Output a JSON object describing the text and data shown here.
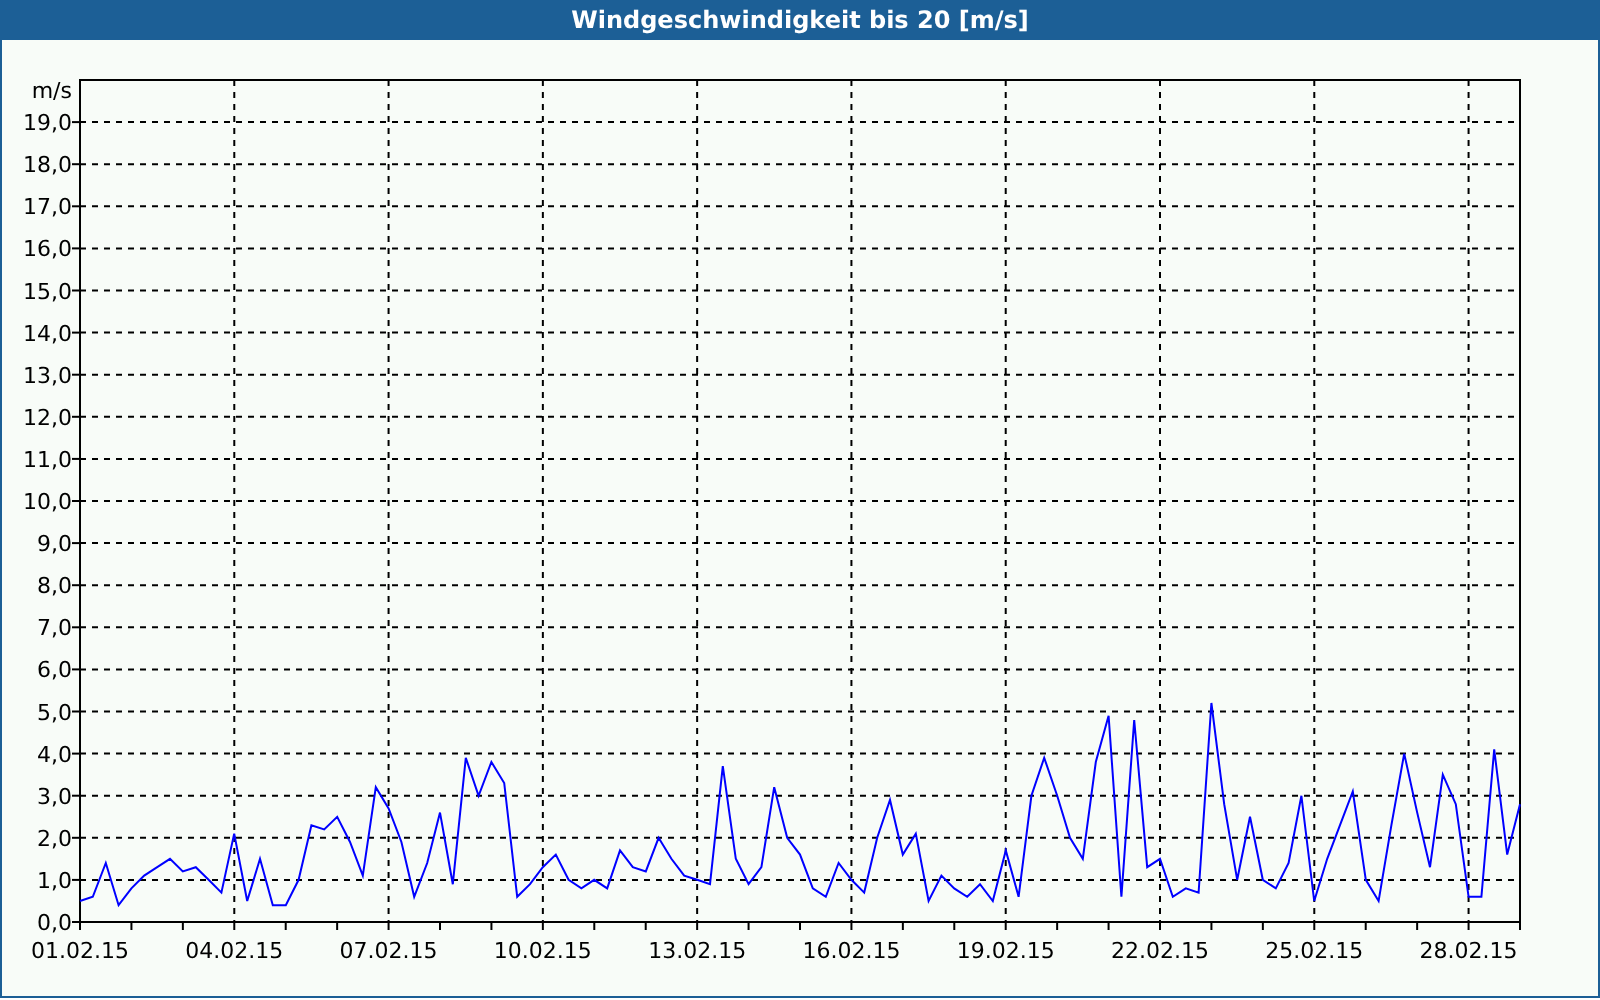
{
  "window": {
    "title": "Windgeschwindigkeit bis 20 [m/s]"
  },
  "chart": {
    "chart_data": {
      "type": "line",
      "grid": true,
      "ylabel": "m/s",
      "ylim": [
        0,
        20
      ],
      "categories": [
        "01.02.15",
        null,
        null,
        null,
        null,
        null,
        null,
        null,
        null,
        null,
        null,
        null,
        "04.02.15",
        null,
        null,
        null,
        null,
        null,
        null,
        null,
        null,
        null,
        null,
        null,
        "07.02.15",
        null,
        null,
        null,
        null,
        null,
        null,
        null,
        null,
        null,
        null,
        null,
        "10.02.15",
        null,
        null,
        null,
        null,
        null,
        null,
        null,
        null,
        null,
        null,
        null,
        "13.02.15",
        null,
        null,
        null,
        null,
        null,
        null,
        null,
        null,
        null,
        null,
        null,
        "16.02.15",
        null,
        null,
        null,
        null,
        null,
        null,
        null,
        null,
        null,
        null,
        null,
        "19.02.15",
        null,
        null,
        null,
        null,
        null,
        null,
        null,
        null,
        null,
        null,
        null,
        "22.02.15",
        null,
        null,
        null,
        null,
        null,
        null,
        null,
        null,
        null,
        null,
        null,
        "25.02.15",
        null,
        null,
        null,
        null,
        null,
        null,
        null,
        null,
        null,
        null,
        null,
        "28.02.15",
        null,
        null,
        null,
        null
      ],
      "yticks": [
        {
          "value": 0,
          "label": "0,0"
        },
        {
          "value": 1,
          "label": "1,0"
        },
        {
          "value": 2,
          "label": "2,0"
        },
        {
          "value": 3,
          "label": "3,0"
        },
        {
          "value": 4,
          "label": "4,0"
        },
        {
          "value": 5,
          "label": "5,0"
        },
        {
          "value": 6,
          "label": "6,0"
        },
        {
          "value": 7,
          "label": "7,0"
        },
        {
          "value": 8,
          "label": "8,0"
        },
        {
          "value": 9,
          "label": "9,0"
        },
        {
          "value": 10,
          "label": "10,0"
        },
        {
          "value": 11,
          "label": "11,0"
        },
        {
          "value": 12,
          "label": "12,0"
        },
        {
          "value": 13,
          "label": "13,0"
        },
        {
          "value": 14,
          "label": "14,0"
        },
        {
          "value": 15,
          "label": "15,0"
        },
        {
          "value": 16,
          "label": "16,0"
        },
        {
          "value": 17,
          "label": "17,0"
        },
        {
          "value": 18,
          "label": "18,0"
        },
        {
          "value": 19,
          "label": "19,0"
        }
      ],
      "series": [
        {
          "color": "#0000ff",
          "values": [
            0.5,
            0.6,
            1.4,
            0.4,
            0.8,
            1.1,
            1.3,
            1.5,
            1.2,
            1.3,
            1.0,
            0.7,
            2.1,
            0.5,
            1.5,
            0.4,
            0.4,
            1.0,
            2.3,
            2.2,
            2.5,
            1.9,
            1.1,
            3.2,
            2.7,
            1.9,
            0.6,
            1.4,
            2.6,
            0.9,
            3.9,
            3.0,
            3.8,
            3.3,
            0.6,
            0.9,
            1.3,
            1.6,
            1.0,
            0.8,
            1.0,
            0.8,
            1.7,
            1.3,
            1.2,
            2.0,
            1.5,
            1.1,
            1.0,
            0.9,
            3.7,
            1.5,
            0.9,
            1.3,
            3.2,
            2.0,
            1.6,
            0.8,
            0.6,
            1.4,
            1.0,
            0.7,
            2.0,
            2.9,
            1.6,
            2.1,
            0.5,
            1.1,
            0.8,
            0.6,
            0.9,
            0.5,
            1.7,
            0.6,
            3.0,
            3.9,
            3.0,
            2.0,
            1.5,
            3.8,
            4.9,
            0.6,
            4.8,
            1.3,
            1.5,
            0.6,
            0.8,
            0.7,
            5.2,
            2.8,
            1.0,
            2.5,
            1.0,
            0.8,
            1.4,
            3.0,
            0.5,
            1.5,
            2.3,
            3.1,
            1.0,
            0.5,
            2.3,
            4.0,
            2.6,
            1.3,
            3.5,
            2.8,
            0.6,
            0.6,
            4.1,
            1.6,
            2.8
          ]
        }
      ]
    }
  }
}
